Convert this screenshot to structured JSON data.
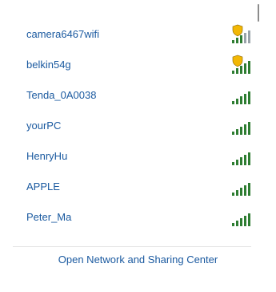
{
  "networks": [
    {
      "name": "camera6467wifi",
      "signal_bars": 3,
      "secured": true
    },
    {
      "name": "belkin54g",
      "signal_bars": 5,
      "secured": true
    },
    {
      "name": "Tenda_0A0038",
      "signal_bars": 5,
      "secured": false
    },
    {
      "name": "yourPC",
      "signal_bars": 5,
      "secured": false
    },
    {
      "name": "HenryHu",
      "signal_bars": 5,
      "secured": false
    },
    {
      "name": "APPLE",
      "signal_bars": 5,
      "secured": false
    },
    {
      "name": "Peter_Ma",
      "signal_bars": 5,
      "secured": false
    }
  ],
  "footer": {
    "link_label": "Open Network and Sharing Center"
  },
  "colors": {
    "link": "#1b5aa0",
    "signal": "#2e7d32",
    "shield": "#f2b705"
  }
}
